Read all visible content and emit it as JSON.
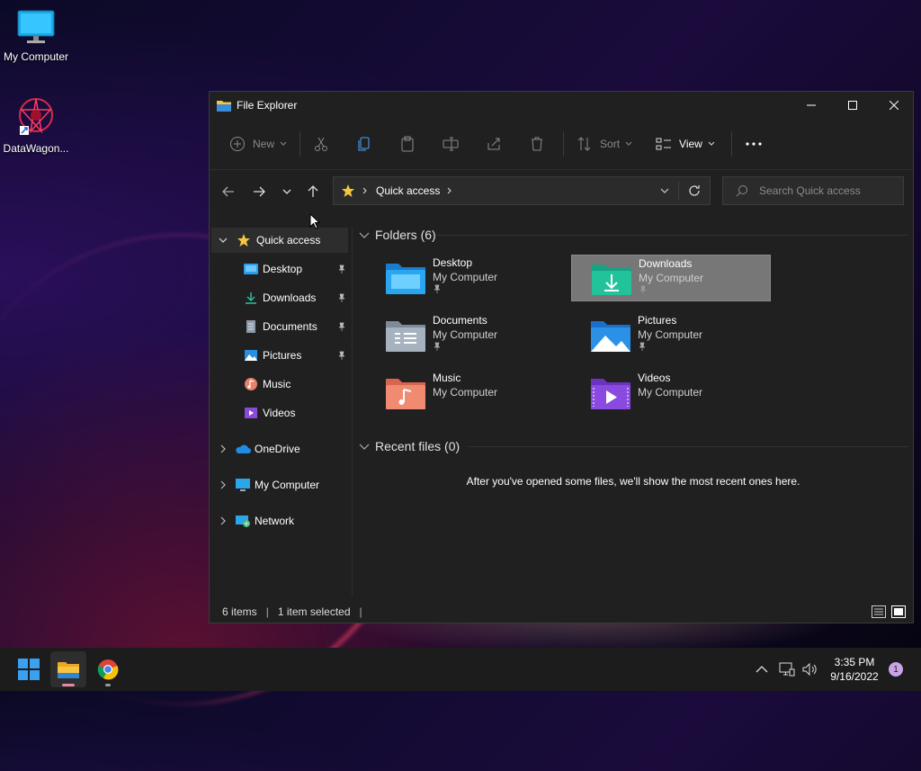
{
  "desktop": {
    "icons": [
      {
        "label": "My Computer"
      },
      {
        "label": "DataWagon..."
      }
    ]
  },
  "window": {
    "title": "File Explorer",
    "toolbar": {
      "new": "New",
      "sort": "Sort",
      "view": "View"
    },
    "address": {
      "path": "Quick access"
    },
    "search": {
      "placeholder": "Search Quick access"
    },
    "sidebar": {
      "quick_access": "Quick access",
      "items": [
        {
          "label": "Desktop"
        },
        {
          "label": "Downloads"
        },
        {
          "label": "Documents"
        },
        {
          "label": "Pictures"
        },
        {
          "label": "Music"
        },
        {
          "label": "Videos"
        }
      ],
      "onedrive": "OneDrive",
      "my_computer": "My Computer",
      "network": "Network"
    },
    "folders_header": "Folders (6)",
    "folders": [
      {
        "name": "Desktop",
        "location": "My Computer"
      },
      {
        "name": "Downloads",
        "location": "My Computer"
      },
      {
        "name": "Documents",
        "location": "My Computer"
      },
      {
        "name": "Pictures",
        "location": "My Computer"
      },
      {
        "name": "Music",
        "location": "My Computer"
      },
      {
        "name": "Videos",
        "location": "My Computer"
      }
    ],
    "recent_header": "Recent files (0)",
    "recent_empty": "After you've opened some files, we'll show the most recent ones here.",
    "status": {
      "items": "6 items",
      "selected": "1 item selected"
    }
  },
  "taskbar": {
    "time": "3:35 PM",
    "date": "9/16/2022",
    "notifications": "1"
  },
  "colors": {
    "accent": "#0078d4",
    "folder": "#f5c542",
    "selection": "#777777"
  }
}
